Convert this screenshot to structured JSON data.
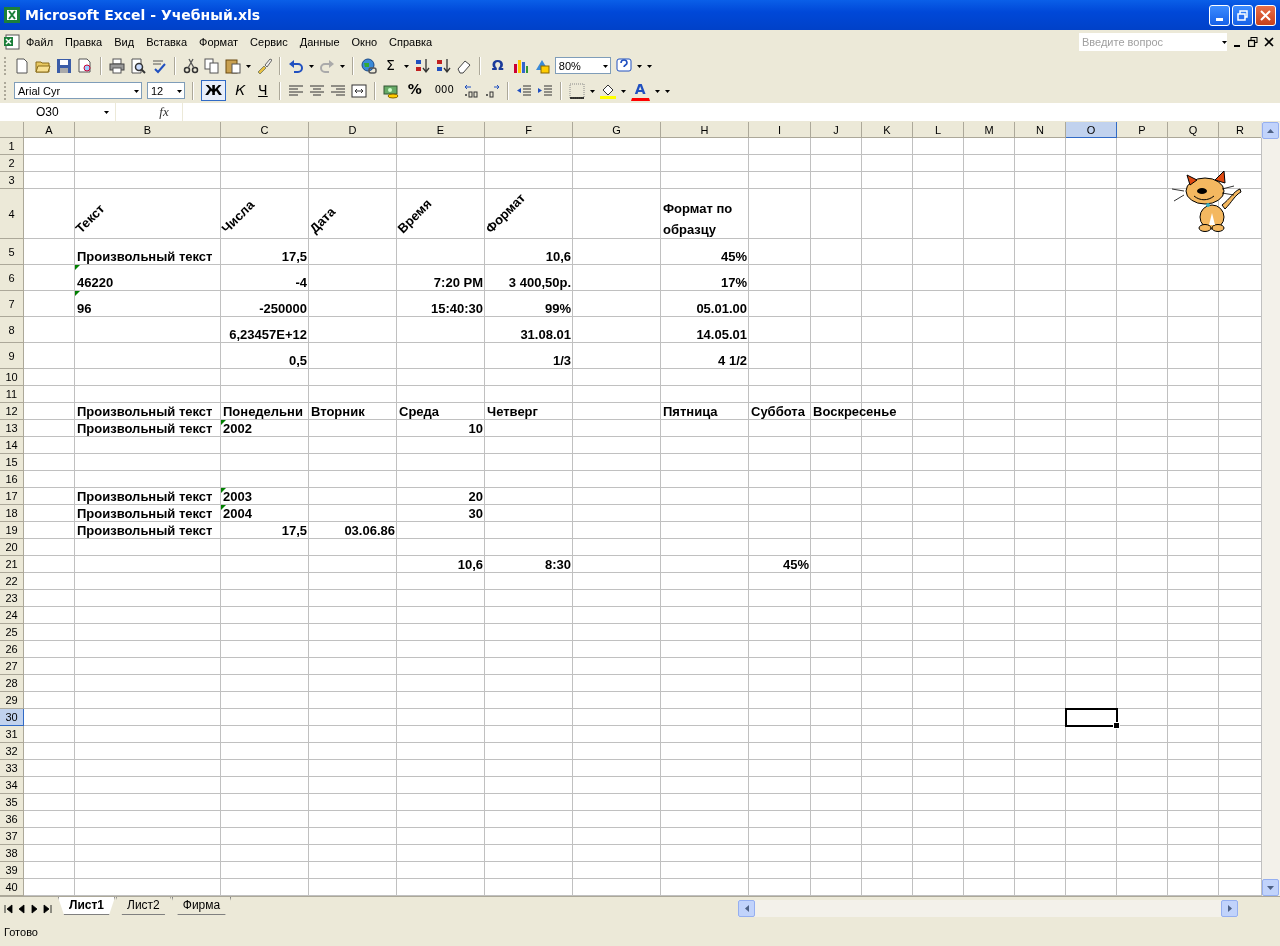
{
  "window": {
    "title": "Microsoft Excel - Учебный.xls"
  },
  "menu": [
    "Файл",
    "Правка",
    "Вид",
    "Вставка",
    "Формат",
    "Сервис",
    "Данные",
    "Окно",
    "Справка"
  ],
  "help_field": {
    "placeholder": "Введите вопрос"
  },
  "standard_toolbar": {
    "sum": "Σ",
    "symbol": "Ω",
    "zoom": "80%"
  },
  "formatting_toolbar": {
    "font": "Arial Cyr",
    "size": "12",
    "style_buttons": [
      {
        "label": "Ж",
        "selected": true
      },
      {
        "label": "К",
        "selected": false
      },
      {
        "label": "Ч",
        "selected": false
      }
    ],
    "percent": "%",
    "thousands": "000",
    "font_color": "A"
  },
  "formula_bar": {
    "name_box": "O30",
    "function_label": "fx"
  },
  "columns": [
    {
      "label": "A",
      "selected": false
    },
    {
      "label": "B",
      "selected": false
    },
    {
      "label": "C",
      "selected": false
    },
    {
      "label": "D",
      "selected": false
    },
    {
      "label": "E",
      "selected": false
    },
    {
      "label": "F",
      "selected": false
    },
    {
      "label": "G",
      "selected": false
    },
    {
      "label": "H",
      "selected": false
    },
    {
      "label": "I",
      "selected": false
    },
    {
      "label": "J",
      "selected": false
    },
    {
      "label": "K",
      "selected": false
    },
    {
      "label": "L",
      "selected": false
    },
    {
      "label": "M",
      "selected": false
    },
    {
      "label": "N",
      "selected": false
    },
    {
      "label": "O",
      "selected": true
    },
    {
      "label": "P",
      "selected": false
    },
    {
      "label": "Q",
      "selected": false
    },
    {
      "label": "R",
      "selected": false
    }
  ],
  "rows": [
    {
      "number": "1",
      "selected": false,
      "cells": {}
    },
    {
      "number": "2",
      "selected": false,
      "cells": {}
    },
    {
      "number": "3",
      "selected": false,
      "cells": {}
    },
    {
      "number": "4",
      "selected": false,
      "cells": {
        "B": {
          "text": "Текст",
          "kind": "rotated",
          "flagged": false
        },
        "C": {
          "text": "Числа",
          "kind": "rotated",
          "flagged": false
        },
        "D": {
          "text": "Дата",
          "kind": "rotated",
          "flagged": false
        },
        "E": {
          "text": "Время",
          "kind": "rotated",
          "flagged": false
        },
        "F": {
          "text": "Формат",
          "kind": "rotated",
          "flagged": false
        },
        "H": {
          "text": "Формат по образцу",
          "kind": "wrapped",
          "flagged": false
        }
      }
    },
    {
      "number": "5",
      "selected": false,
      "cells": {
        "B": {
          "text": "Произвольный текст",
          "kind": "text",
          "flagged": false
        },
        "C": {
          "text": "17,5",
          "kind": "number",
          "flagged": false
        },
        "F": {
          "text": "10,6",
          "kind": "number",
          "flagged": false
        },
        "H": {
          "text": "45%",
          "kind": "number",
          "flagged": false
        }
      }
    },
    {
      "number": "6",
      "selected": false,
      "cells": {
        "B": {
          "text": "46220",
          "kind": "text",
          "flagged": true
        },
        "C": {
          "text": "-4",
          "kind": "number",
          "flagged": false
        },
        "E": {
          "text": "7:20 PM",
          "kind": "number",
          "flagged": false
        },
        "F": {
          "text": "3 400,50р.",
          "kind": "number",
          "flagged": false
        },
        "H": {
          "text": "17%",
          "kind": "number",
          "flagged": false
        }
      }
    },
    {
      "number": "7",
      "selected": false,
      "cells": {
        "B": {
          "text": "96",
          "kind": "text",
          "flagged": true
        },
        "C": {
          "text": "-250000",
          "kind": "number",
          "flagged": false
        },
        "E": {
          "text": "15:40:30",
          "kind": "number",
          "flagged": false
        },
        "F": {
          "text": "99%",
          "kind": "number",
          "flagged": false
        },
        "H": {
          "text": "05.01.00",
          "kind": "number",
          "flagged": false
        }
      }
    },
    {
      "number": "8",
      "selected": false,
      "cells": {
        "C": {
          "text": "6,23457E+12",
          "kind": "number",
          "flagged": false
        },
        "F": {
          "text": "31.08.01",
          "kind": "number",
          "flagged": false
        },
        "H": {
          "text": "14.05.01",
          "kind": "number",
          "flagged": false
        }
      }
    },
    {
      "number": "9",
      "selected": false,
      "cells": {
        "C": {
          "text": "0,5",
          "kind": "number",
          "flagged": false
        },
        "F": {
          "text": "1/3",
          "kind": "number",
          "flagged": false
        },
        "H": {
          "text": "4 1/2",
          "kind": "number",
          "flagged": false
        }
      }
    },
    {
      "number": "10",
      "selected": false,
      "cells": {}
    },
    {
      "number": "11",
      "selected": false,
      "cells": {}
    },
    {
      "number": "12",
      "selected": false,
      "cells": {
        "B": {
          "text": "Произвольный текст",
          "kind": "text",
          "flagged": false
        },
        "C": {
          "text": "Понедельни",
          "kind": "text",
          "flagged": false
        },
        "D": {
          "text": "Вторник",
          "kind": "text",
          "flagged": false
        },
        "E": {
          "text": "Среда",
          "kind": "text",
          "flagged": false
        },
        "F": {
          "text": "Четверг",
          "kind": "text",
          "flagged": false
        },
        "H": {
          "text": "Пятница",
          "kind": "text",
          "flagged": false
        },
        "I": {
          "text": "Суббота",
          "kind": "text",
          "flagged": false
        },
        "J": {
          "text": "Воскресенье",
          "kind": "text",
          "flagged": false
        }
      }
    },
    {
      "number": "13",
      "selected": false,
      "cells": {
        "B": {
          "text": "Произвольный текст",
          "kind": "text",
          "flagged": false
        },
        "C": {
          "text": "2002",
          "kind": "text",
          "flagged": true
        },
        "E": {
          "text": "10",
          "kind": "number",
          "flagged": false
        }
      }
    },
    {
      "number": "14",
      "selected": false,
      "cells": {}
    },
    {
      "number": "15",
      "selected": false,
      "cells": {}
    },
    {
      "number": "16",
      "selected": false,
      "cells": {}
    },
    {
      "number": "17",
      "selected": false,
      "cells": {
        "B": {
          "text": "Произвольный текст",
          "kind": "text",
          "flagged": false
        },
        "C": {
          "text": "2003",
          "kind": "text",
          "flagged": true
        },
        "E": {
          "text": "20",
          "kind": "number",
          "flagged": false
        }
      }
    },
    {
      "number": "18",
      "selected": false,
      "cells": {
        "B": {
          "text": "Произвольный текст",
          "kind": "text",
          "flagged": false
        },
        "C": {
          "text": "2004",
          "kind": "text",
          "flagged": true
        },
        "E": {
          "text": "30",
          "kind": "number",
          "flagged": false
        }
      }
    },
    {
      "number": "19",
      "selected": false,
      "cells": {
        "B": {
          "text": "Произвольный текст",
          "kind": "text",
          "flagged": false
        },
        "C": {
          "text": "17,5",
          "kind": "number",
          "flagged": false
        },
        "D": {
          "text": "03.06.86",
          "kind": "number",
          "flagged": false
        }
      }
    },
    {
      "number": "20",
      "selected": false,
      "cells": {}
    },
    {
      "number": "21",
      "selected": false,
      "cells": {
        "E": {
          "text": "10,6",
          "kind": "number",
          "flagged": false
        },
        "F": {
          "text": "8:30",
          "kind": "number",
          "flagged": false
        },
        "I": {
          "text": "45%",
          "kind": "number",
          "flagged": false
        }
      }
    },
    {
      "number": "22",
      "selected": false,
      "cells": {}
    },
    {
      "number": "23",
      "selected": false,
      "cells": {}
    },
    {
      "number": "24",
      "selected": false,
      "cells": {}
    },
    {
      "number": "25",
      "selected": false,
      "cells": {}
    },
    {
      "number": "26",
      "selected": false,
      "cells": {}
    },
    {
      "number": "27",
      "selected": false,
      "cells": {}
    },
    {
      "number": "28",
      "selected": false,
      "cells": {}
    },
    {
      "number": "29",
      "selected": false,
      "cells": {}
    },
    {
      "number": "30",
      "selected": true,
      "cells": {}
    },
    {
      "number": "31",
      "selected": false,
      "cells": {}
    },
    {
      "number": "32",
      "selected": false,
      "cells": {}
    },
    {
      "number": "33",
      "selected": false,
      "cells": {}
    },
    {
      "number": "34",
      "selected": false,
      "cells": {}
    },
    {
      "number": "35",
      "selected": false,
      "cells": {}
    },
    {
      "number": "36",
      "selected": false,
      "cells": {}
    },
    {
      "number": "37",
      "selected": false,
      "cells": {}
    },
    {
      "number": "38",
      "selected": false,
      "cells": {}
    },
    {
      "number": "39",
      "selected": false,
      "cells": {}
    },
    {
      "number": "40",
      "selected": false,
      "cells": {}
    }
  ],
  "sheet_tabs": [
    {
      "label": "Лист1",
      "selected": true
    },
    {
      "label": "Лист2",
      "selected": false
    },
    {
      "label": "Фирма",
      "selected": false
    }
  ],
  "status_bar": {
    "text": "Готово"
  }
}
